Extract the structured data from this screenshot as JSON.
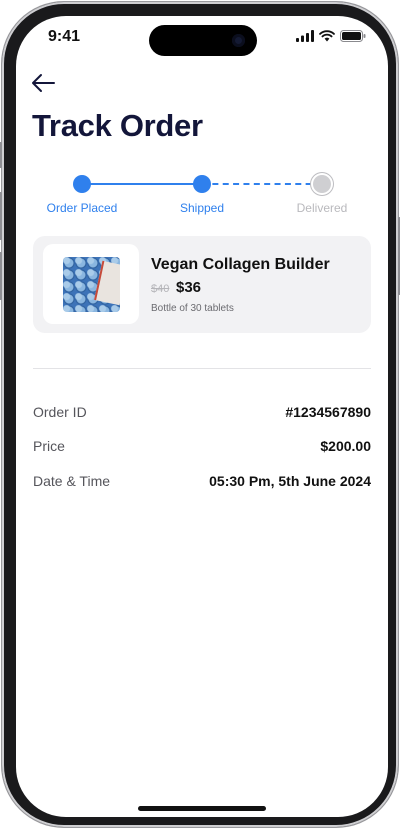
{
  "status_bar": {
    "time": "9:41"
  },
  "header": {
    "back_icon": "arrow-left-icon",
    "title": "Track Order"
  },
  "tracking": {
    "steps": [
      {
        "label": "Order Placed",
        "state": "completed"
      },
      {
        "label": "Shipped",
        "state": "completed"
      },
      {
        "label": "Delivered",
        "state": "pending"
      }
    ],
    "accent_color": "#2f80ed",
    "pending_color": "#b9b9bd"
  },
  "product": {
    "name": "Vegan Collagen Builder",
    "old_price": "$40",
    "price": "$36",
    "pack": "Bottle of 30 tablets"
  },
  "details": [
    {
      "label": "Order ID",
      "value": "#1234567890"
    },
    {
      "label": "Price",
      "value": "$200.00"
    },
    {
      "label": "Date & Time",
      "value": "05:30 Pm, 5th June 2024"
    }
  ],
  "colors": {
    "title": "#13163a",
    "card_bg": "#f2f2f4"
  }
}
